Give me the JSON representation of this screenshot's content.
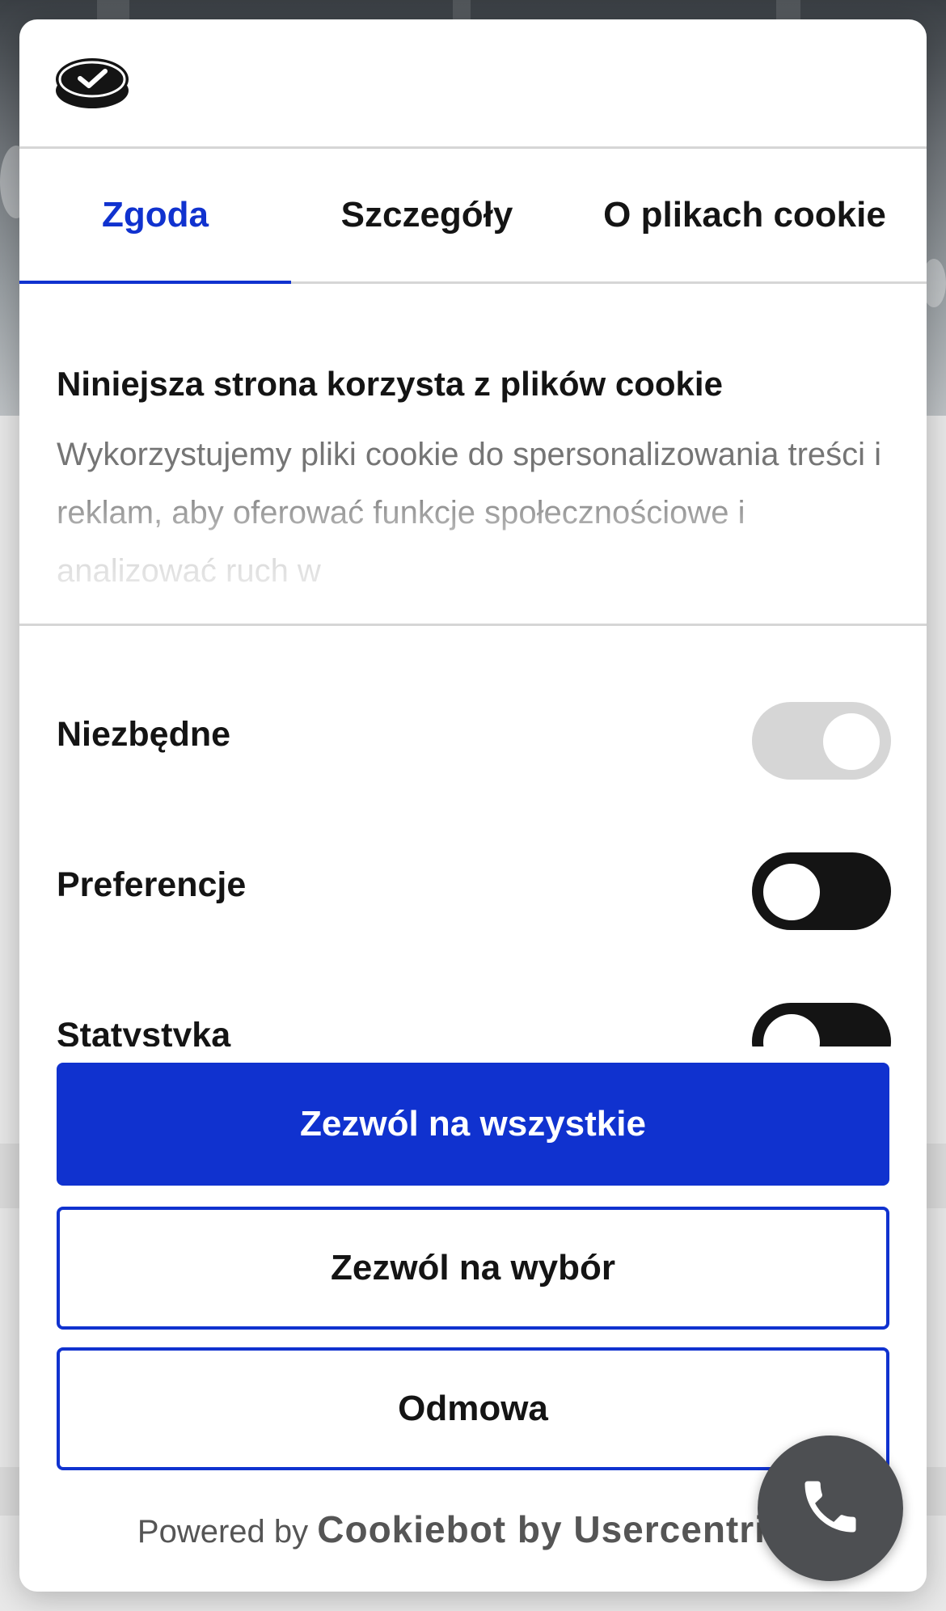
{
  "tabs": [
    {
      "label": "Zgoda",
      "active": true
    },
    {
      "label": "Szczegóły",
      "active": false
    },
    {
      "label": "O plikach cookie",
      "active": false
    }
  ],
  "content": {
    "title": "Niniejsza strona korzysta z plików cookie",
    "body": "Wykorzystujemy pliki cookie do spersonalizowania treści i reklam, aby oferować funkcje społecznościowe i analizować ruch w"
  },
  "toggles": [
    {
      "label": "Niezbędne",
      "enabled": true,
      "locked": true
    },
    {
      "label": "Preferencje",
      "enabled": false,
      "locked": false
    },
    {
      "label": "Statystyka",
      "enabled": false,
      "locked": false
    }
  ],
  "buttons": {
    "allow_all": "Zezwól na wszystkie",
    "allow_selection": "Zezwól na wybór",
    "deny": "Odmowa"
  },
  "footer": {
    "powered_prefix": "Powered by",
    "powered_brand": "Cookiebot by Usercentrics"
  },
  "colors": {
    "accent": "#1032cf",
    "text": "#141414",
    "muted": "#757575",
    "fab": "#4d4f52"
  },
  "icons": {
    "logo": "cookiebot-logo-icon",
    "call": "phone-icon"
  }
}
